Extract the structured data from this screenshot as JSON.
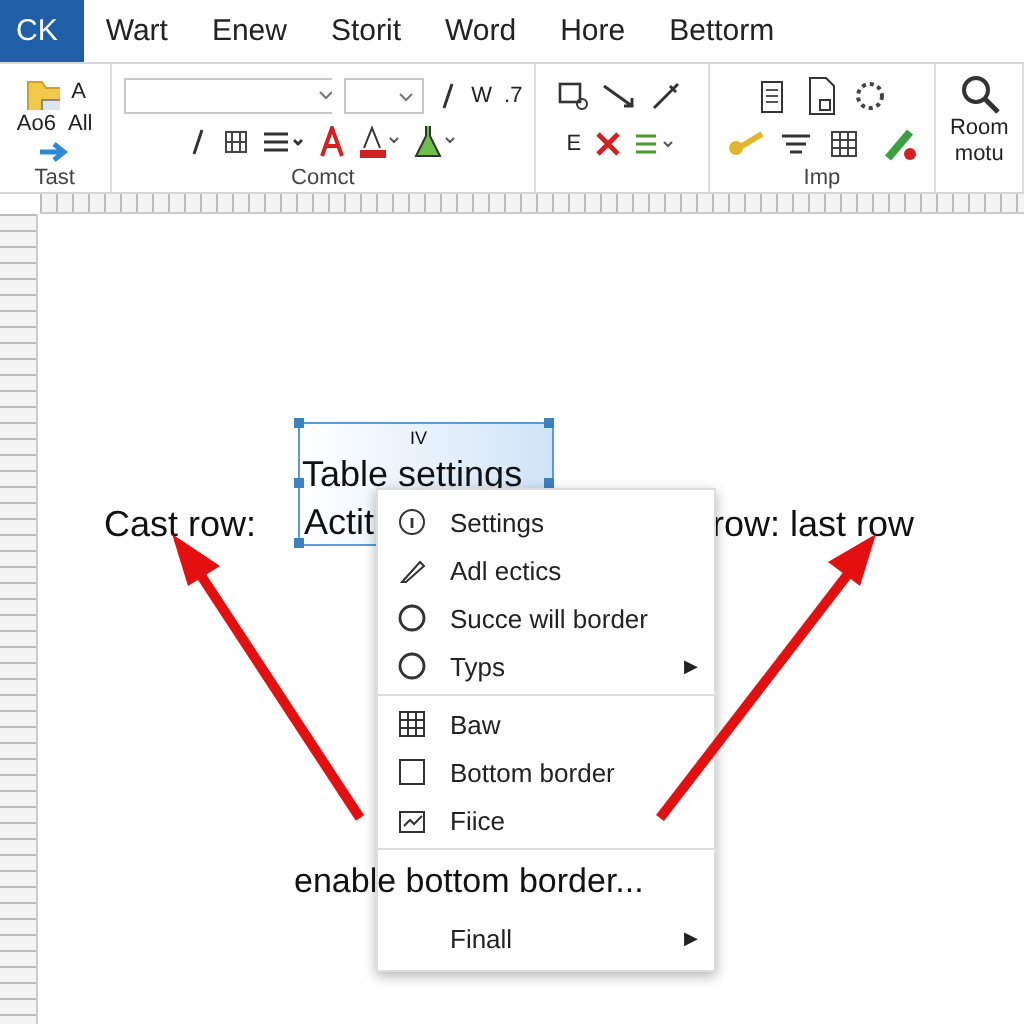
{
  "tabs": [
    {
      "label": "CK",
      "selected": true
    },
    {
      "label": "Wart",
      "selected": false
    },
    {
      "label": "Enew",
      "selected": false
    },
    {
      "label": "Storit",
      "selected": false
    },
    {
      "label": "Word",
      "selected": false
    },
    {
      "label": "Hore",
      "selected": false
    },
    {
      "label": "Bettorm",
      "selected": false
    }
  ],
  "ribbon": {
    "groups": [
      {
        "label": "Tast",
        "texts": [
          "Ao6",
          "A",
          "All"
        ]
      },
      {
        "label": "Comct",
        "texts": [
          "W",
          ".7"
        ]
      },
      {
        "texts": [
          "E"
        ]
      },
      {
        "label": "Imp"
      },
      {
        "texts": [
          "Room",
          "motu"
        ]
      }
    ]
  },
  "document": {
    "textbox_tag": "IV",
    "title": "Table settings",
    "title_line2": "Actit",
    "left_label": "Cast row:",
    "right_label": "row: last row",
    "caption": "enable bottom border..."
  },
  "context_menu": {
    "items": [
      {
        "label": "Settings"
      },
      {
        "label": "Adl ectics"
      },
      {
        "label": "Succe will border"
      },
      {
        "label": "Typs",
        "arrow": "▶",
        "separator_after": true
      },
      {
        "label": "Baw"
      },
      {
        "label": "Bottom border"
      },
      {
        "label": "Fiice",
        "separator_after": true
      },
      {
        "label": "Finall",
        "arrow": "▶"
      }
    ]
  }
}
